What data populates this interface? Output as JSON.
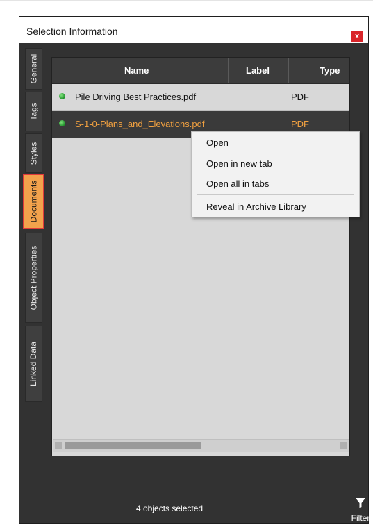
{
  "window": {
    "title": "Selection Information",
    "close_label": "x"
  },
  "tabs": [
    "General",
    "Tags",
    "Styles",
    "Documents",
    "Object Properties",
    "Linked Data"
  ],
  "active_tab": "Documents",
  "table": {
    "columns": [
      "Name",
      "Label",
      "Type"
    ],
    "rows": [
      {
        "name": "Pile Driving Best Practices.pdf",
        "label": "",
        "type": "PDF"
      },
      {
        "name": "S-1-0-Plans_and_Elevations.pdf",
        "label": "",
        "type": "PDF"
      }
    ]
  },
  "context_menu": {
    "items": [
      "Open",
      "Open in new tab",
      "Open all in tabs"
    ],
    "separated_item": "Reveal in Archive Library"
  },
  "footer": {
    "status": "4 objects selected",
    "filter_label": "Filter"
  },
  "colors": {
    "active_tab": "#f2a24c",
    "selected_row_text": "#f0a040",
    "close_button": "#d9252a"
  },
  "icons": {
    "status_dot": "green-dot-icon",
    "filter": "funnel-icon"
  }
}
